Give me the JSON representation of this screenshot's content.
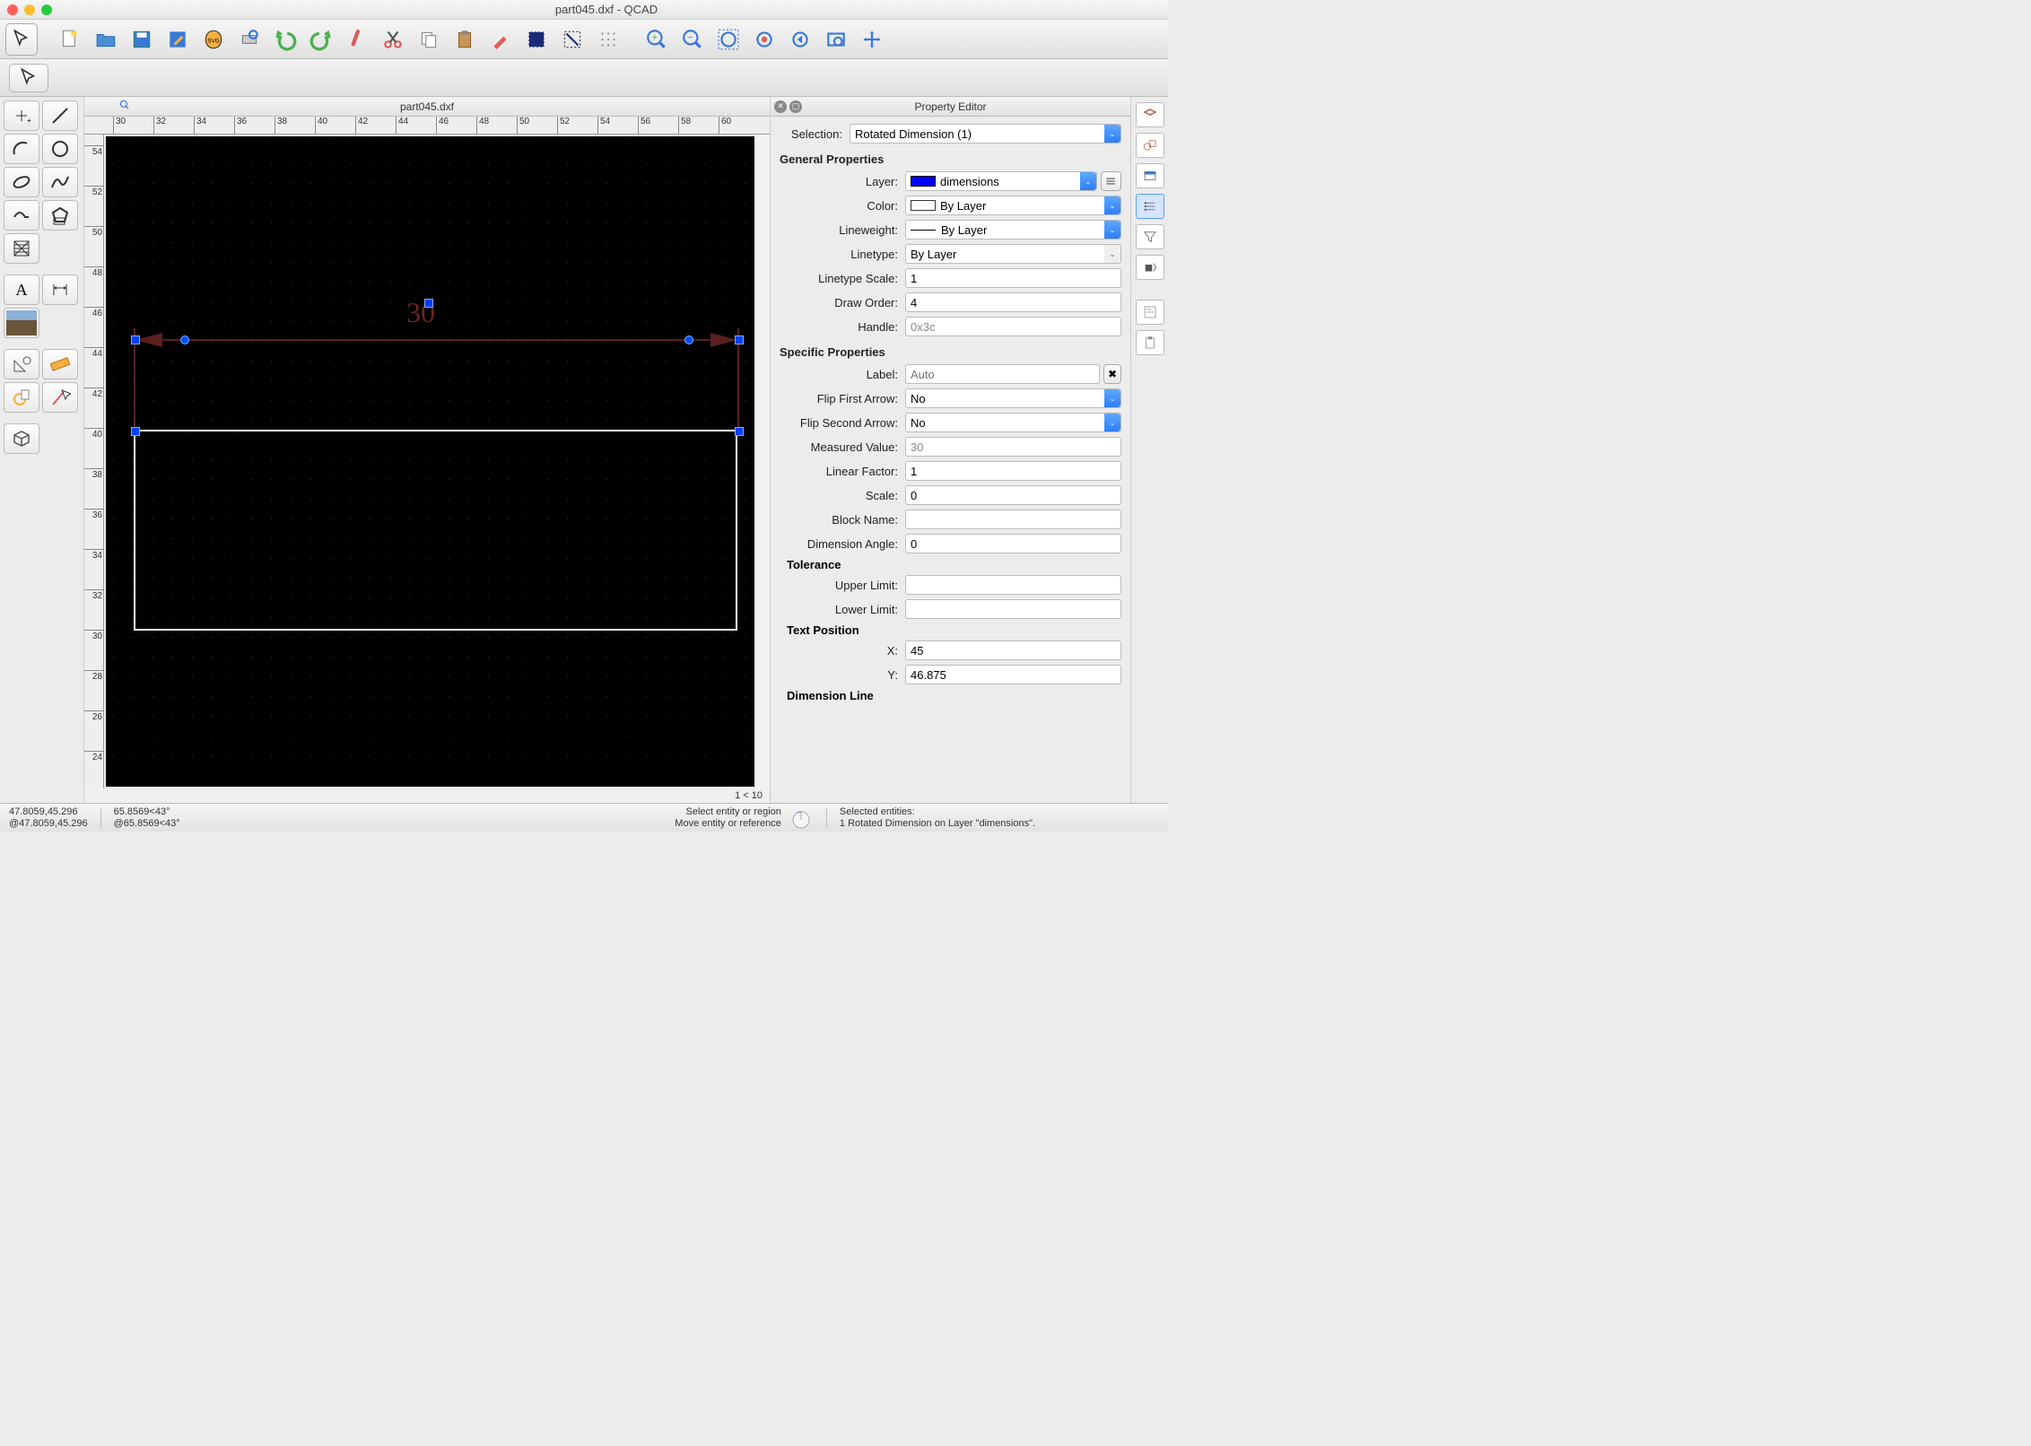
{
  "window": {
    "title": "part045.dxf - QCAD"
  },
  "document": {
    "name": "part045.dxf"
  },
  "rulers": {
    "h": [
      "30",
      "32",
      "34",
      "36",
      "38",
      "40",
      "42",
      "44",
      "46",
      "48",
      "50",
      "52",
      "54",
      "56",
      "58",
      "60"
    ],
    "v": [
      "54",
      "52",
      "50",
      "48",
      "46",
      "44",
      "42",
      "40",
      "38",
      "36",
      "34",
      "32",
      "30",
      "28",
      "26",
      "24"
    ]
  },
  "canvas": {
    "dim_text": "30",
    "scroll_label": "1 < 10"
  },
  "property_editor": {
    "title": "Property Editor",
    "selection_label": "Selection:",
    "selection_value": "Rotated Dimension (1)",
    "general_title": "General Properties",
    "layer_label": "Layer:",
    "layer_value": "dimensions",
    "layer_color": "#0000ff",
    "color_label": "Color:",
    "color_value": "By Layer",
    "color_swatch": "#ffffff",
    "lineweight_label": "Lineweight:",
    "lineweight_value": "By Layer",
    "linetype_label": "Linetype:",
    "linetype_value": "By Layer",
    "linetype_scale_label": "Linetype Scale:",
    "linetype_scale_value": "1",
    "draw_order_label": "Draw Order:",
    "draw_order_value": "4",
    "handle_label": "Handle:",
    "handle_value": "0x3c",
    "specific_title": "Specific Properties",
    "label_label": "Label:",
    "label_placeholder": "Auto",
    "flip_first_label": "Flip First Arrow:",
    "flip_first_value": "No",
    "flip_second_label": "Flip Second Arrow:",
    "flip_second_value": "No",
    "measured_label": "Measured Value:",
    "measured_value": "30",
    "linear_factor_label": "Linear Factor:",
    "linear_factor_value": "1",
    "scale_label": "Scale:",
    "scale_value": "0",
    "block_name_label": "Block Name:",
    "block_name_value": "",
    "dim_angle_label": "Dimension Angle:",
    "dim_angle_value": "0",
    "tolerance_title": "Tolerance",
    "upper_limit_label": "Upper Limit:",
    "upper_limit_value": "",
    "lower_limit_label": "Lower Limit:",
    "lower_limit_value": "",
    "text_pos_title": "Text Position",
    "x_label": "X:",
    "x_value": "45",
    "y_label": "Y:",
    "y_value": "46.875",
    "dim_line_title": "Dimension Line"
  },
  "status": {
    "abs": "47.8059,45.296",
    "rel": "@47.8059,45.296",
    "polar_abs": "65.8569<43°",
    "polar_rel": "@65.8569<43°",
    "hint1": "Select entity or region",
    "hint2": "Move entity or reference",
    "sel_title": "Selected entities:",
    "sel_detail": "1 Rotated Dimension on Layer \"dimensions\"."
  }
}
